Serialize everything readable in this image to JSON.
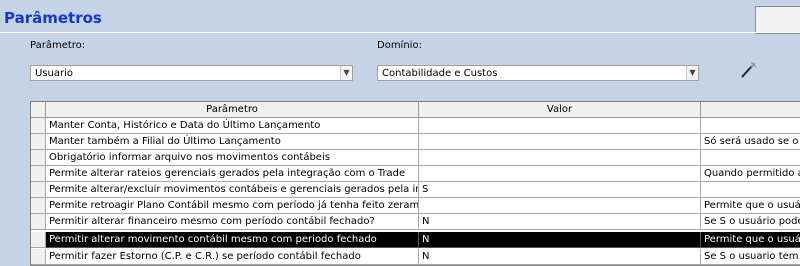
{
  "header": {
    "title": "Parâmetros"
  },
  "filters": {
    "parametro_label": "Parâmetro:",
    "parametro_value": "Usuario",
    "dominio_label": "Domínio:",
    "dominio_value": "Contabilidade e Custos"
  },
  "table": {
    "columns": [
      "Parâmetro",
      "Valor",
      ""
    ],
    "rows": [
      {
        "param": "Manter Conta, Histórico e Data do Último Lançamento",
        "valor": "",
        "desc": ""
      },
      {
        "param": "Manter também a Filial do Último Lançamento",
        "valor": "",
        "desc": "Só será usado se o pa"
      },
      {
        "param": "Obrigatório informar arquivo nos movimentos contábeis",
        "valor": "",
        "desc": ""
      },
      {
        "param": "Permite alterar rateios gerenciais gerados pela integração com o Trade",
        "valor": "",
        "desc": "Quando permitido altera"
      },
      {
        "param": "Permite alterar/excluir movimentos contábeis e gerenciais gerados pela integração",
        "valor": "S",
        "desc": ""
      },
      {
        "param": "Permite retroagir Plano Contábil mesmo com período já tenha feito zeramento",
        "valor": "",
        "desc": "Permite que o usuário a"
      },
      {
        "param": "Permitir alterar financeiro mesmo com período contábil fechado?",
        "valor": "N",
        "desc": "Se S o usuário poderá"
      },
      {
        "param": "Permitir alterar movimento contábil mesmo com periodo fechado",
        "valor": "N",
        "desc": "Permite que o usuário a"
      },
      {
        "param": "Permitir fazer Estorno (C.P. e C.R.) se período contábil fechado",
        "valor": "N",
        "desc": "Se S o usuario tem per"
      }
    ],
    "selected_row": 7
  },
  "colors": {
    "background": "#c4d3e6",
    "title": "#1538c8",
    "selected_row": "#000000"
  }
}
